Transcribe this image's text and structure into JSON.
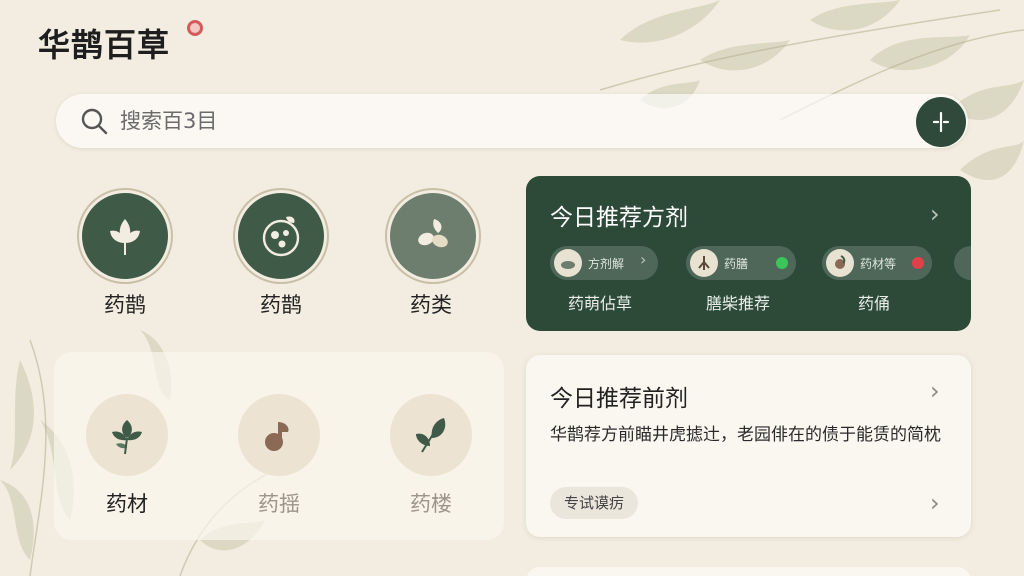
{
  "app": {
    "title": "华鹊百草"
  },
  "search": {
    "placeholder": "搜索百3目"
  },
  "icons": {
    "title_seal": "seal-icon",
    "search": "search-icon",
    "voice": "voice-icon",
    "chevron": "chevron-right-icon"
  },
  "categories_top": [
    {
      "label": "药鹊",
      "icon": "leaf-icon"
    },
    {
      "label": "药鹊",
      "icon": "herb-bowl-icon"
    },
    {
      "label": "药类",
      "icon": "seeds-icon"
    }
  ],
  "categories_grid": [
    {
      "label": "药材",
      "icon": "sprig-icon"
    },
    {
      "label": "药揺",
      "icon": "mushroom-icon"
    },
    {
      "label": "药楼",
      "icon": "branch-icon"
    }
  ],
  "recommend": {
    "title": "今日推荐方剂",
    "chips": [
      {
        "text": "方剂解",
        "icon": "herb-bowl-icon"
      },
      {
        "text": "药膳",
        "icon": "ginseng-icon",
        "dot": "#3cc55a"
      },
      {
        "text": "药材等",
        "icon": "mushroom-icon",
        "dot": "#e0404a"
      }
    ],
    "subtitles": [
      "药萌佔草",
      "膳柴推荐",
      "药俑"
    ]
  },
  "prescription": {
    "title": "今日推荐前剂",
    "description": "华鹊荐方前瞄井虎摅辻，老园俳在的债于能赁的简枕",
    "tag": "专试谟疠"
  },
  "colors": {
    "background": "#f3ede1",
    "accent": "#2d4a39",
    "seal": "#d25b5b"
  }
}
